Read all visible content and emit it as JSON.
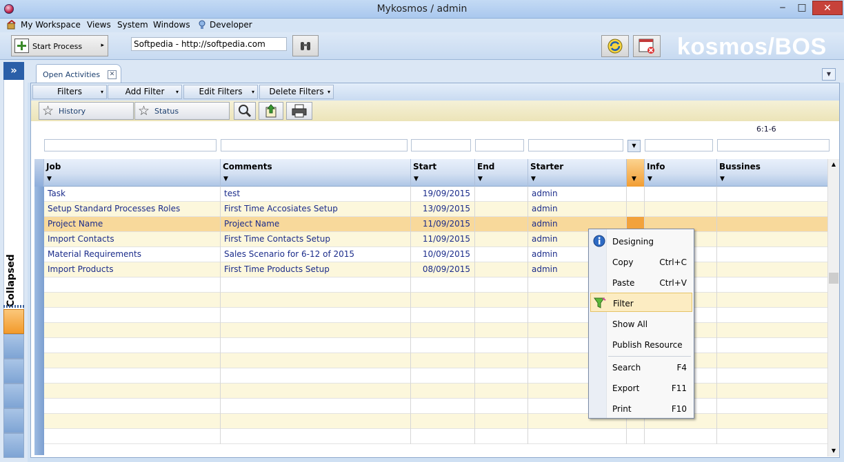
{
  "window": {
    "title": "Mykosmos / admin",
    "min": "‒",
    "max": "□",
    "close": "✕"
  },
  "menu": {
    "workspace": "My Workspace",
    "views": "Views",
    "system": "System",
    "windows": "Windows",
    "developer": "Developer"
  },
  "toolbar": {
    "start_process": "Start Process",
    "start_process_arrow": "▸",
    "url": "Softpedia - http://softpedia.com",
    "brand": "kosmos/BOS"
  },
  "sidebar": {
    "expand": "»",
    "collapsed_label": "Collapsed"
  },
  "tab": {
    "label": "Open Activities",
    "close": "✕",
    "menu_arrow": "▼"
  },
  "filterbar": {
    "filters": "Filters",
    "add_filter": "Add Filter",
    "edit_filters": "Edit Filters",
    "delete_filters": "Delete Filters",
    "dd": "▾"
  },
  "viewbar": {
    "history": "History",
    "status": "Status",
    "star": "☆"
  },
  "grid": {
    "page_info": "6:1-6",
    "sort_arrow": "▼",
    "columns": {
      "job": "Job",
      "comments": "Comments",
      "start": "Start",
      "end": "End",
      "starter": "Starter",
      "info": "Info",
      "bussines": "Bussines"
    },
    "rows": [
      {
        "job": "Task",
        "comments": "test",
        "start": "19/09/2015",
        "end": "",
        "starter": "admin"
      },
      {
        "job": "Setup Standard Processes Roles",
        "comments": "First Time Accosiates Setup",
        "start": "13/09/2015",
        "end": "",
        "starter": "admin"
      },
      {
        "job": "Project Name",
        "comments": "Project Name",
        "start": "11/09/2015",
        "end": "",
        "starter": "admin"
      },
      {
        "job": "Import Contacts",
        "comments": "First Time Contacts Setup",
        "start": "11/09/2015",
        "end": "",
        "starter": "admin"
      },
      {
        "job": "Material Requirements",
        "comments": "Sales Scenario for 6-12 of 2015",
        "start": "10/09/2015",
        "end": "",
        "starter": "admin"
      },
      {
        "job": "Import Products",
        "comments": "First Time Products Setup",
        "start": "08/09/2015",
        "end": "",
        "starter": "admin"
      }
    ]
  },
  "context_menu": {
    "designing": "Designing",
    "copy": "Copy",
    "copy_sc": "Ctrl+C",
    "paste": "Paste",
    "paste_sc": "Ctrl+V",
    "filter": "Filter",
    "show_all": "Show All",
    "publish": "Publish Resource",
    "search": "Search",
    "search_sc": "F4",
    "export": "Export",
    "export_sc": "F11",
    "print": "Print",
    "print_sc": "F10"
  },
  "colors": {
    "accent_orange": "#f29d32",
    "row_alt": "#fcf7dc",
    "row_highlight": "#f8d99b",
    "close_red": "#c7423a"
  }
}
